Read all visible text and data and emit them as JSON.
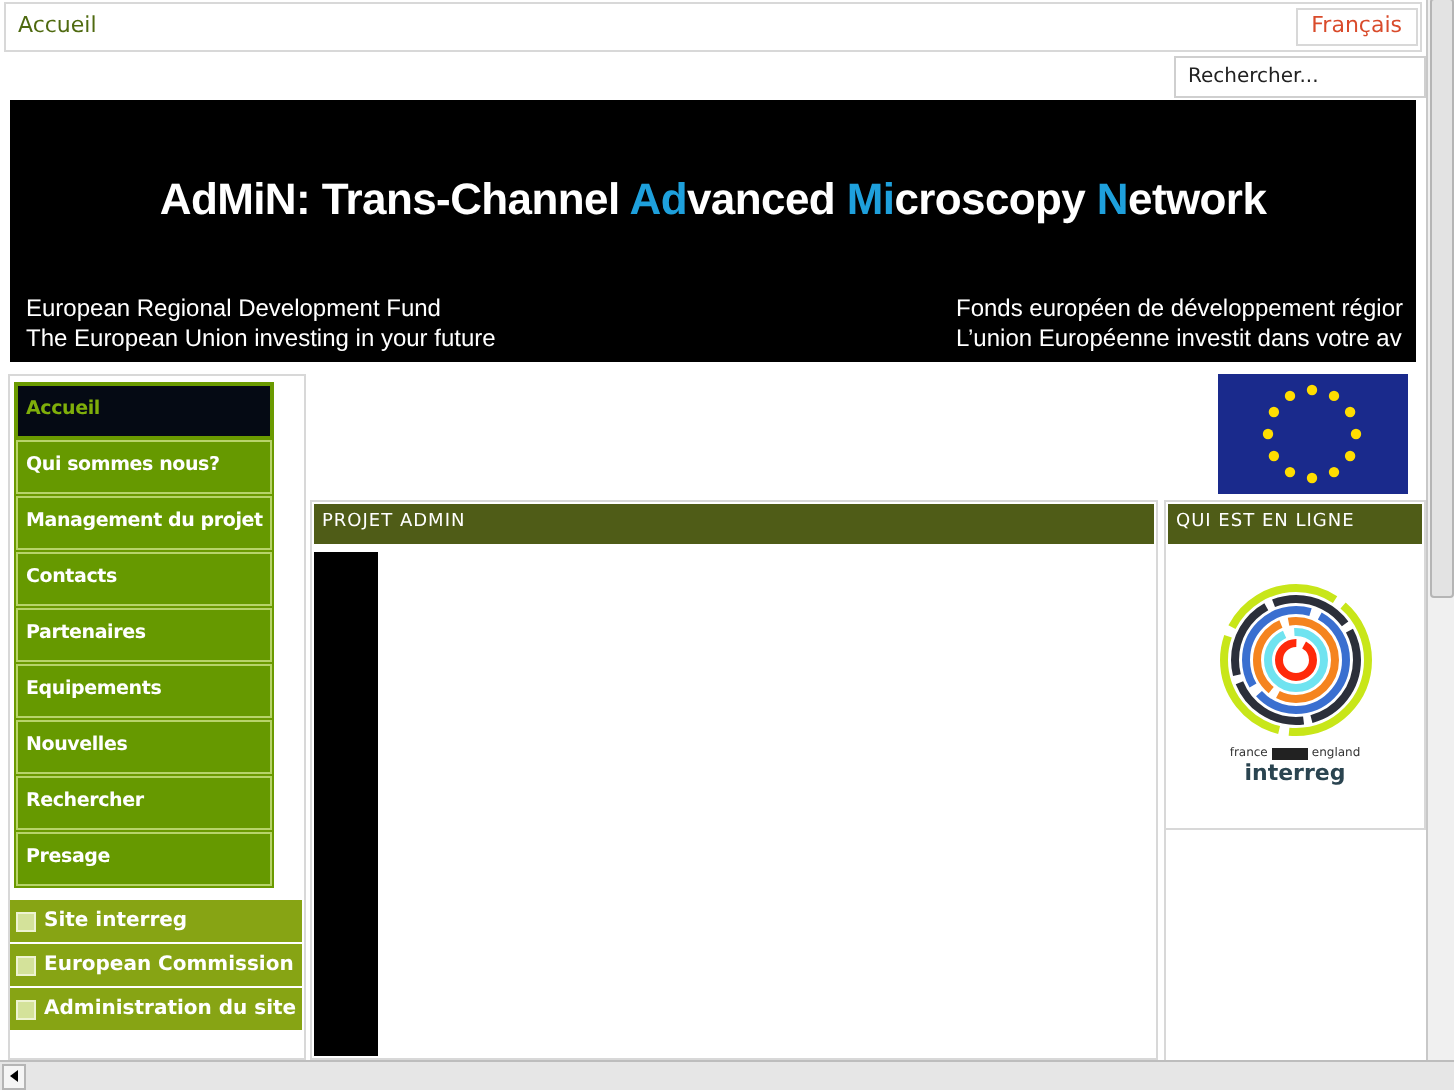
{
  "breadcrumb": "Accueil",
  "language_button": "Français",
  "search": {
    "placeholder": "Rechercher..."
  },
  "banner": {
    "title": [
      {
        "text": "AdMiN: Trans-Channel ",
        "accent": false
      },
      {
        "text": "Ad",
        "accent": true
      },
      {
        "text": "vanced ",
        "accent": false
      },
      {
        "text": "Mi",
        "accent": true
      },
      {
        "text": "croscopy ",
        "accent": false
      },
      {
        "text": "N",
        "accent": true
      },
      {
        "text": "etwork",
        "accent": false
      }
    ],
    "left_lines": [
      "European Regional Development Fund",
      "The European Union investing in your future"
    ],
    "right_lines": [
      "Fonds européen de développement régior",
      "L’union Européenne investit dans votre av"
    ]
  },
  "menu": [
    {
      "label": "Accueil",
      "selected": true
    },
    {
      "label": "Qui sommes nous?",
      "selected": false
    },
    {
      "label": "Management du projet",
      "selected": false
    },
    {
      "label": "Contacts",
      "selected": false
    },
    {
      "label": "Partenaires",
      "selected": false
    },
    {
      "label": "Equipements",
      "selected": false
    },
    {
      "label": "Nouvelles",
      "selected": false
    },
    {
      "label": "Rechercher",
      "selected": false
    },
    {
      "label": "Presage",
      "selected": false
    }
  ],
  "links": [
    "Site interreg",
    "European Commission",
    "Administration du site"
  ],
  "main_panel": {
    "title": "PROJET ADMIN"
  },
  "side_panel": {
    "title": "QUI EST EN LIGNE",
    "logo_caption_left": "france",
    "logo_caption_right": "england",
    "logo_name": "interreg"
  }
}
